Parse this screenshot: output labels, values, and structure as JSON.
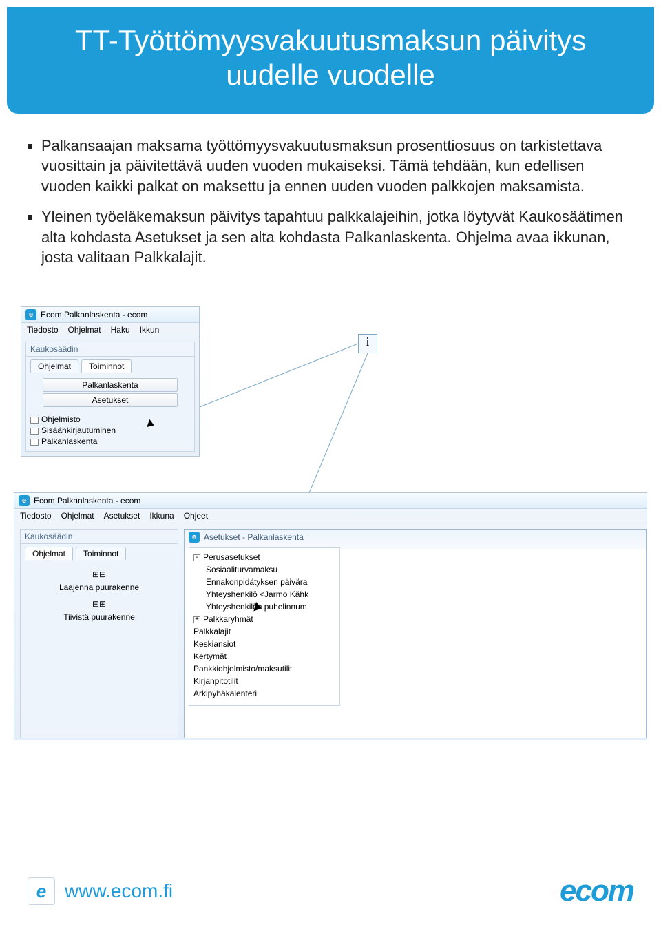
{
  "title": "TT-Työttömyysvakuutusmaksun päivitys uudelle vuodelle",
  "bullets": [
    "Palkansaajan maksama työttömyysvakuutusmaksun prosenttiosuus on tarkistettava vuosittain ja päivitettävä uuden vuoden mukaiseksi. Tämä tehdään, kun edellisen vuoden kaikki palkat on maksettu ja ennen uuden vuoden palkkojen maksamista.",
    "Yleinen työeläkemaksun päivitys tapahtuu palkkalajeihin, jotka löytyvät Kaukosäätimen alta kohdasta Asetukset ja sen alta kohdasta Palkanlaskenta. Ohjelma avaa ikkunan, josta valitaan Palkkalajit."
  ],
  "callout": "i",
  "win1": {
    "title": "Ecom Palkanlaskenta - ecom",
    "menu": [
      "Tiedosto",
      "Ohjelmat",
      "Haku",
      "Ikkun"
    ],
    "panel_title": "Kaukosäädin",
    "tabs": [
      "Ohjelmat",
      "Toiminnot"
    ],
    "buttons": [
      "Palkanlaskenta",
      "Asetukset"
    ],
    "tree": [
      "Ohjelmisto",
      "Sisäänkirjautuminen",
      "Palkanlaskenta"
    ]
  },
  "win2": {
    "title": "Ecom Palkanlaskenta - ecom",
    "menu": [
      "Tiedosto",
      "Ohjelmat",
      "Asetukset",
      "Ikkuna",
      "Ohjeet"
    ],
    "sidebar": {
      "panel_title": "Kaukosäädin",
      "tabs": [
        "Ohjelmat",
        "Toiminnot"
      ],
      "expand_label": "Laajenna puurakenne",
      "collapse_label": "Tiivistä puurakenne"
    },
    "settings": {
      "title": "Asetukset - Palkanlaskenta",
      "tree_root": "Perusasetukset",
      "tree_children": [
        "Sosiaaliturvamaksu",
        "Ennakonpidätyksen päivära",
        "Yhteyshenkilö <Jarmo Kähk",
        "Yhteyshenkilön puhelinnum"
      ],
      "tree_siblings_after": [
        "Palkkaryhmät",
        "Palkkalajit",
        "Keskiansiot",
        "Kertymät",
        "Pankkiohjelmisto/maksutilit",
        "Kirjanpitotilit",
        "Arkipyhäkalenteri"
      ]
    }
  },
  "footer": {
    "url": "www.ecom.fi",
    "logo_text_small": "e",
    "logo_text_big": "ecom"
  }
}
